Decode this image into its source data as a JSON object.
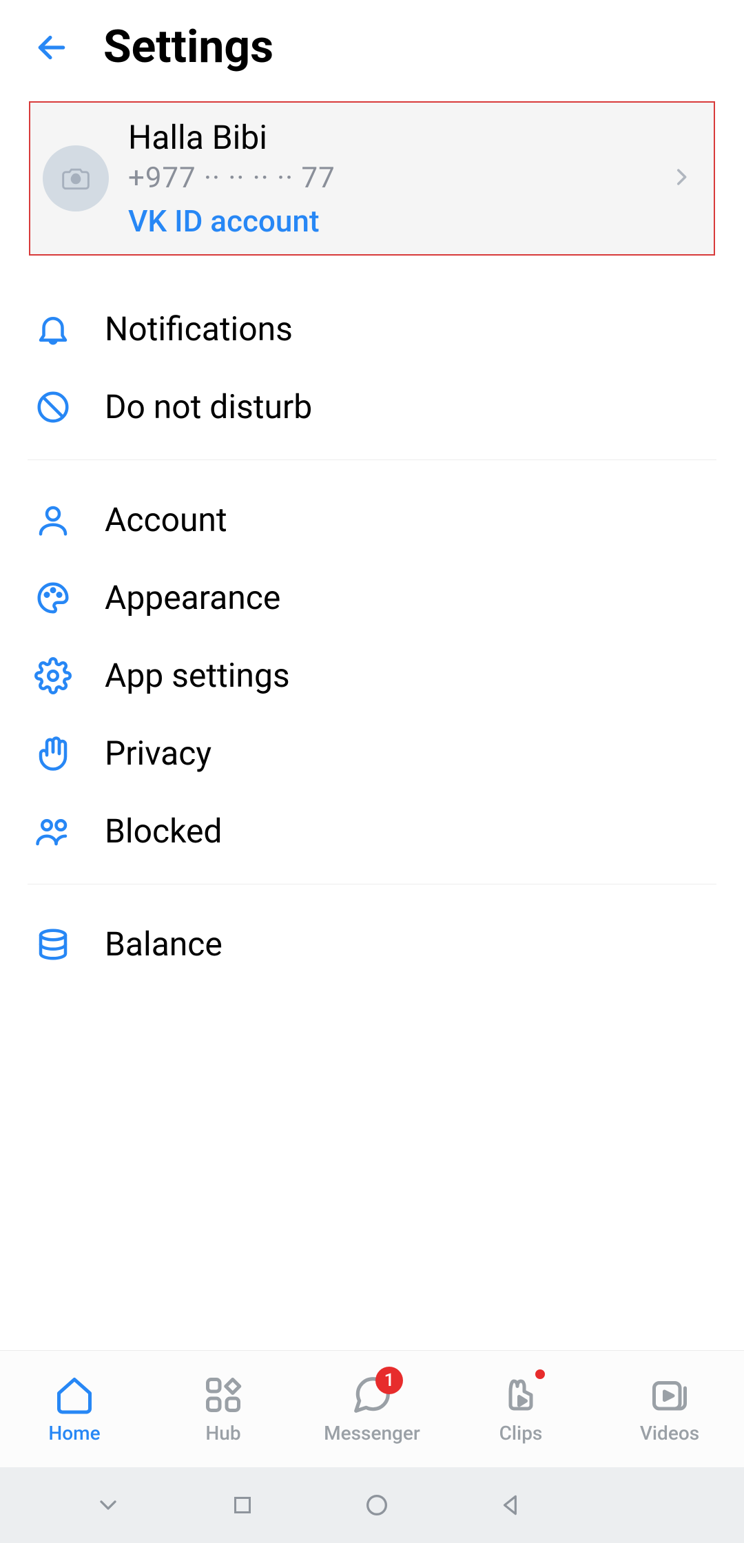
{
  "colors": {
    "accent": "#2787f5",
    "muted": "#9aa0a6",
    "highlight_border": "#d83b3b",
    "badge": "#e72c2c"
  },
  "header": {
    "title": "Settings"
  },
  "profile": {
    "name": "Halla Bibi",
    "phone": "+977  ··  ··  ··  ·· 77",
    "vkid_label": "VK ID account"
  },
  "groups": [
    {
      "items": [
        {
          "key": "notifications",
          "label": "Notifications",
          "icon": "bell-icon"
        },
        {
          "key": "dnd",
          "label": "Do not disturb",
          "icon": "prohibit-icon"
        }
      ]
    },
    {
      "items": [
        {
          "key": "account",
          "label": "Account",
          "icon": "user-icon"
        },
        {
          "key": "appearance",
          "label": "Appearance",
          "icon": "palette-icon"
        },
        {
          "key": "appsettings",
          "label": "App settings",
          "icon": "gear-icon"
        },
        {
          "key": "privacy",
          "label": "Privacy",
          "icon": "hand-icon"
        },
        {
          "key": "blocked",
          "label": "Blocked",
          "icon": "group-icon"
        }
      ]
    },
    {
      "items": [
        {
          "key": "balance",
          "label": "Balance",
          "icon": "coins-icon"
        }
      ]
    }
  ],
  "nav": {
    "items": [
      {
        "key": "home",
        "label": "Home",
        "icon": "home-icon",
        "active": true
      },
      {
        "key": "hub",
        "label": "Hub",
        "icon": "hub-icon"
      },
      {
        "key": "messenger",
        "label": "Messenger",
        "icon": "chat-icon",
        "badge": "1"
      },
      {
        "key": "clips",
        "label": "Clips",
        "icon": "clips-icon",
        "dot": true
      },
      {
        "key": "videos",
        "label": "Videos",
        "icon": "video-icon"
      }
    ]
  }
}
